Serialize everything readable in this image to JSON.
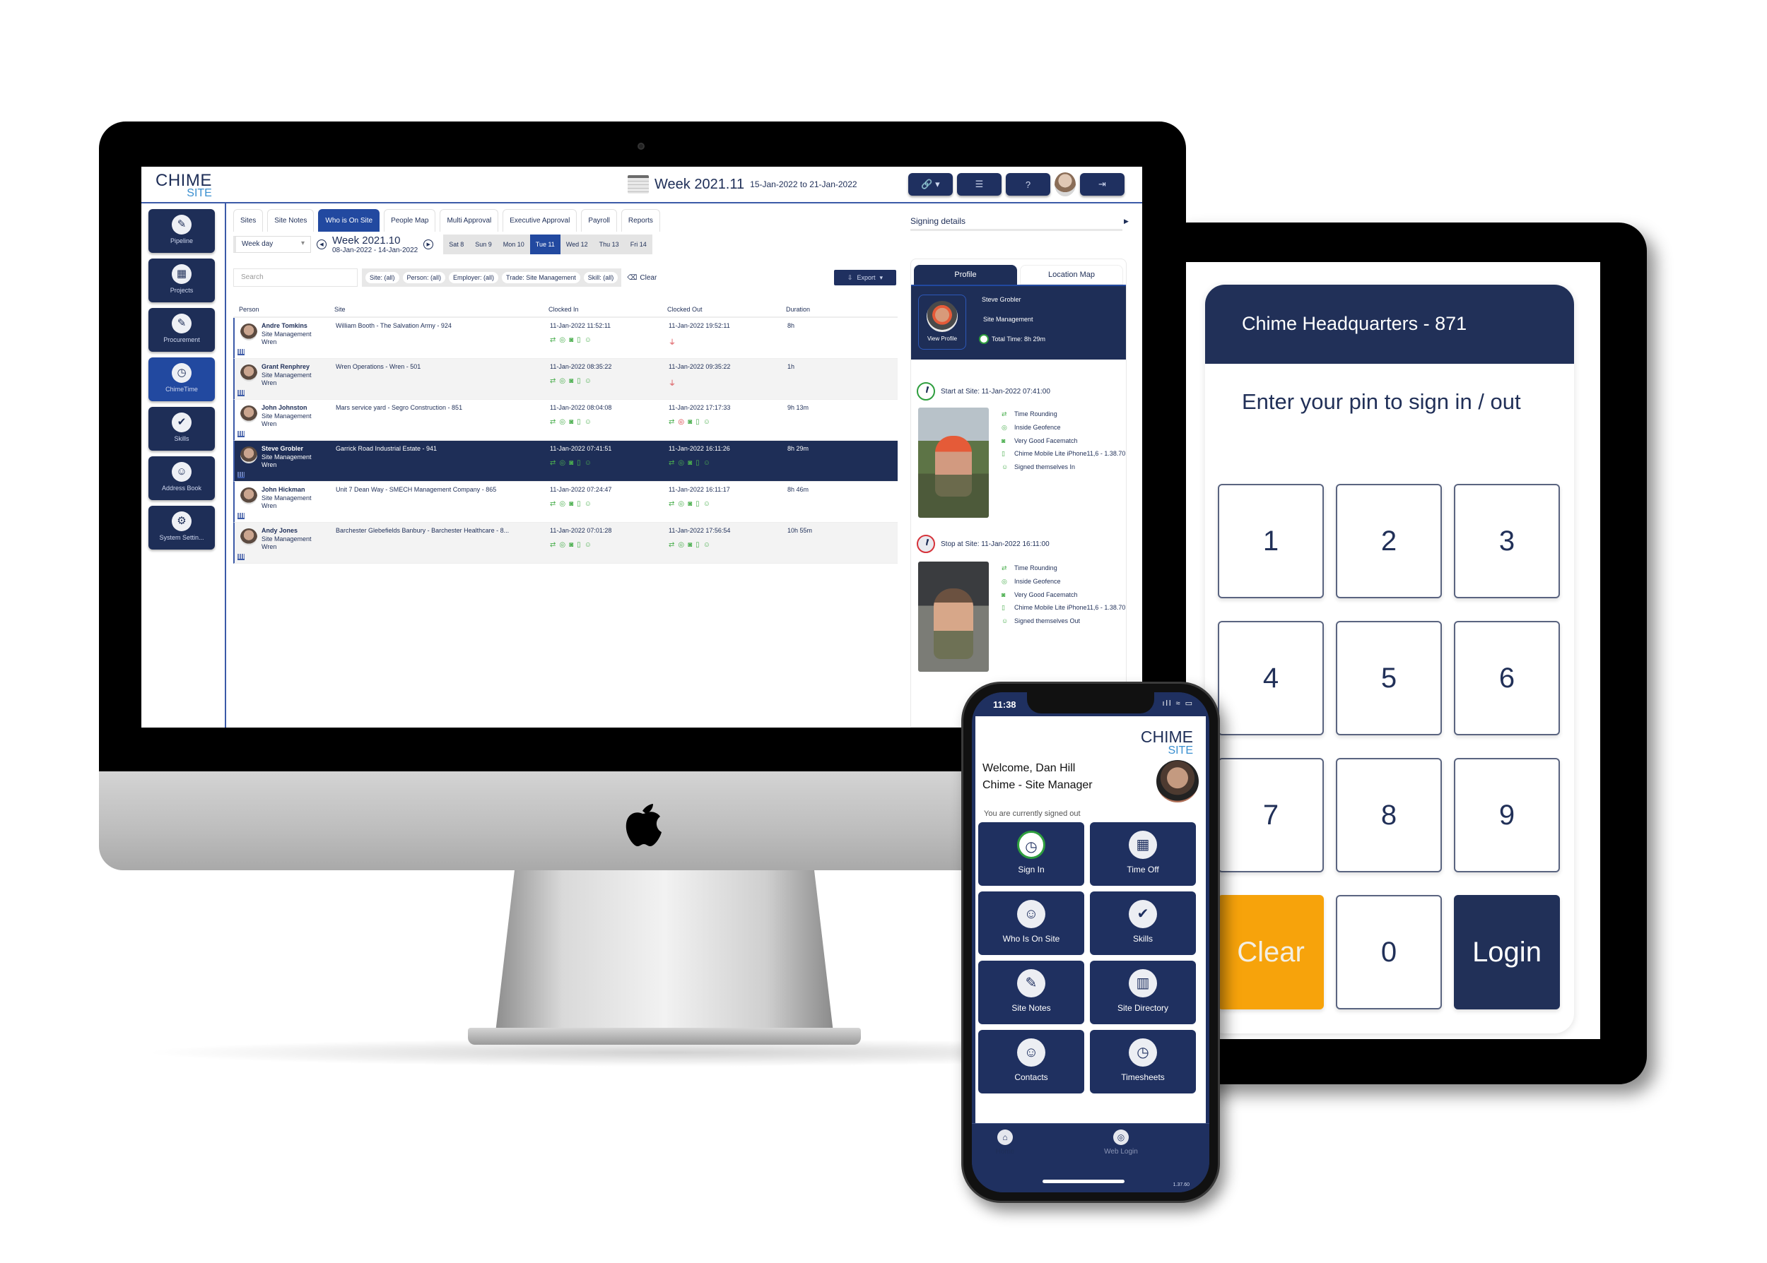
{
  "colors": {
    "navy": "#1e2e57",
    "active_blue": "#2249a0",
    "ok_green": "#4caf50",
    "alert_red": "#d6333a",
    "clear_orange": "#f7a30b",
    "logo_blue": "#3a8fd0"
  },
  "desktop": {
    "logo": {
      "word": "CHIME",
      "sub": "SITE"
    },
    "header": {
      "week_title": "Week 2021.11",
      "week_range": "15-Jan-2022 to 21-Jan-2022"
    },
    "top_buttons": [
      {
        "icon": "link-icon",
        "glyph": "🔗 ▾"
      },
      {
        "icon": "checklist-icon",
        "glyph": "☰"
      },
      {
        "icon": "help-icon",
        "glyph": "?"
      },
      {
        "icon": "logout-icon",
        "glyph": "⇥"
      }
    ],
    "sidebar": [
      {
        "label": "Pipeline",
        "glyph": "✎",
        "active": false
      },
      {
        "label": "Projects",
        "glyph": "▦",
        "active": false
      },
      {
        "label": "Procurement",
        "glyph": "✎",
        "active": false
      },
      {
        "label": "ChimeTime",
        "glyph": "◷",
        "active": true
      },
      {
        "label": "Skills",
        "glyph": "✔",
        "active": false
      },
      {
        "label": "Address Book",
        "glyph": "☺",
        "active": false
      },
      {
        "label": "System Settin...",
        "glyph": "⚙",
        "active": false
      }
    ],
    "tabs": [
      "Sites",
      "Site Notes",
      "Who is On Site",
      "People Map",
      "Multi Approval",
      "Executive Approval",
      "Payroll",
      "Reports"
    ],
    "active_tab": "Who is On Site",
    "period_select": "Week day",
    "week": {
      "title": "Week 2021.10",
      "range": "08-Jan-2022 - 14-Jan-2022"
    },
    "days": [
      "Sat 8",
      "Sun 9",
      "Mon 10",
      "Tue 11",
      "Wed 12",
      "Thu 13",
      "Fri 14"
    ],
    "active_day": "Tue 11",
    "search_placeholder": "Search",
    "filters": [
      "Site: (all)",
      "Person: (all)",
      "Employer: (all)",
      "Trade: Site Management",
      "Skill: (all)"
    ],
    "clear_label": "Clear",
    "export_label": "Export",
    "table": {
      "columns": [
        "Person",
        "Site",
        "Clocked In",
        "Clocked Out",
        "Duration"
      ],
      "rows": [
        {
          "name": "Andre Tomkins",
          "trade": "Site Management",
          "employer": "Wren",
          "site": "William Booth - The Salvation Army - 924",
          "clocked_in": "11-Jan-2022 11:52:11",
          "clocked_out": "11-Jan-2022 19:52:11",
          "duration": "8h",
          "out_status": "unplugged"
        },
        {
          "name": "Grant Renphrey",
          "trade": "Site Management",
          "employer": "Wren",
          "site": "Wren Operations - Wren - 501",
          "clocked_in": "11-Jan-2022 08:35:22",
          "clocked_out": "11-Jan-2022 09:35:22",
          "duration": "1h",
          "out_status": "unplugged"
        },
        {
          "name": "John Johnston",
          "trade": "Site Management",
          "employer": "Wren",
          "site": "Mars service yard - Segro Construction - 851",
          "clocked_in": "11-Jan-2022 08:04:08",
          "clocked_out": "11-Jan-2022 17:17:33",
          "duration": "9h 13m",
          "out_status": "outside-geofence"
        },
        {
          "name": "Steve Grobler",
          "trade": "Site Management",
          "employer": "Wren",
          "site": "Garrick Road Industrial Estate - 941",
          "clocked_in": "11-Jan-2022 07:41:51",
          "clocked_out": "11-Jan-2022 16:11:26",
          "duration": "8h 29m",
          "out_status": "ok",
          "selected": true
        },
        {
          "name": "John Hickman",
          "trade": "Site Management",
          "employer": "Wren",
          "site": "Unit 7 Dean Way - SMECH Management Company - 865",
          "clocked_in": "11-Jan-2022 07:24:47",
          "clocked_out": "11-Jan-2022 16:11:17",
          "duration": "8h 46m",
          "out_status": "ok"
        },
        {
          "name": "Andy Jones",
          "trade": "Site Management",
          "employer": "Wren",
          "site": "Barchester Glebefields Banbury - Barchester Healthcare - 8...",
          "clocked_in": "11-Jan-2022 07:01:28",
          "clocked_out": "11-Jan-2022 17:56:54",
          "duration": "10h 55m",
          "out_status": "ok"
        }
      ]
    },
    "signing": {
      "title": "Signing details",
      "tabs": [
        "Profile",
        "Location Map"
      ],
      "profile": {
        "name": "Steve Grobler",
        "trade": "Site Management",
        "view_profile": "View Profile",
        "total_time": "Total Time: 8h 29m"
      },
      "start": {
        "label": "Start at Site: 11-Jan-2022 07:41:00",
        "details": [
          "Time Rounding",
          "Inside Geofence",
          "Very Good Facematch",
          "Chime Mobile Lite iPhone11,6 - 1.38.70",
          "Signed themselves In"
        ]
      },
      "stop": {
        "label": "Stop at Site: 11-Jan-2022 16:11:00",
        "details": [
          "Time Rounding",
          "Inside Geofence",
          "Very Good Facematch",
          "Chime Mobile Lite iPhone11,6 - 1.38.70",
          "Signed themselves Out"
        ]
      }
    }
  },
  "tablet": {
    "site_title": "Chime Headquarters - 871",
    "prompt": "Enter your pin to sign in / out",
    "keys": [
      "1",
      "2",
      "3",
      "4",
      "5",
      "6",
      "7",
      "8",
      "9",
      "Clear",
      "0",
      "Login"
    ]
  },
  "phone": {
    "status_time": "11:38",
    "status_icons": "ıll ≈ ▭",
    "logo": {
      "word": "CHIME",
      "sub": "SITE"
    },
    "welcome": "Welcome, Dan Hill",
    "role": "Chime - Site Manager",
    "sign_state": "You are currently signed out",
    "tiles": [
      {
        "label": "Sign In",
        "glyph": "◷"
      },
      {
        "label": "Time Off",
        "glyph": "▦"
      },
      {
        "label": "Who Is On Site",
        "glyph": "☺"
      },
      {
        "label": "Skills",
        "glyph": "✔"
      },
      {
        "label": "Site Notes",
        "glyph": "✎"
      },
      {
        "label": "Site Directory",
        "glyph": "▥"
      },
      {
        "label": "Contacts",
        "glyph": "☺"
      },
      {
        "label": "Timesheets",
        "glyph": "◷"
      }
    ],
    "tab_bar": [
      {
        "label": "Home",
        "glyph": "⌂"
      },
      {
        "label": "Web Login",
        "glyph": "◎"
      }
    ],
    "version": "1.37.60"
  }
}
